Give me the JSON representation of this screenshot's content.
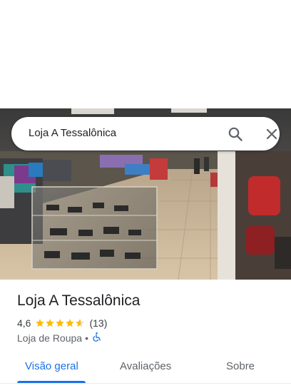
{
  "search": {
    "query": "Loja A Tessalônica"
  },
  "place": {
    "name": "Loja A Tessalônica",
    "rating": "4,6",
    "stars_value": 4.6,
    "stars_max": 5,
    "review_count": "(13)",
    "category": "Loja de Roupa",
    "separator": "•",
    "accessibility_icon": "wheelchair-icon"
  },
  "tabs": [
    {
      "label": "Visão geral",
      "active": true
    },
    {
      "label": "Avaliações",
      "active": false
    },
    {
      "label": "Sobre",
      "active": false
    }
  ],
  "colors": {
    "accent": "#1a73e8",
    "star": "#fbbc04",
    "text_primary": "#202124",
    "text_secondary": "#5f6368"
  },
  "icons": {
    "search": "search-icon",
    "close": "close-icon"
  }
}
